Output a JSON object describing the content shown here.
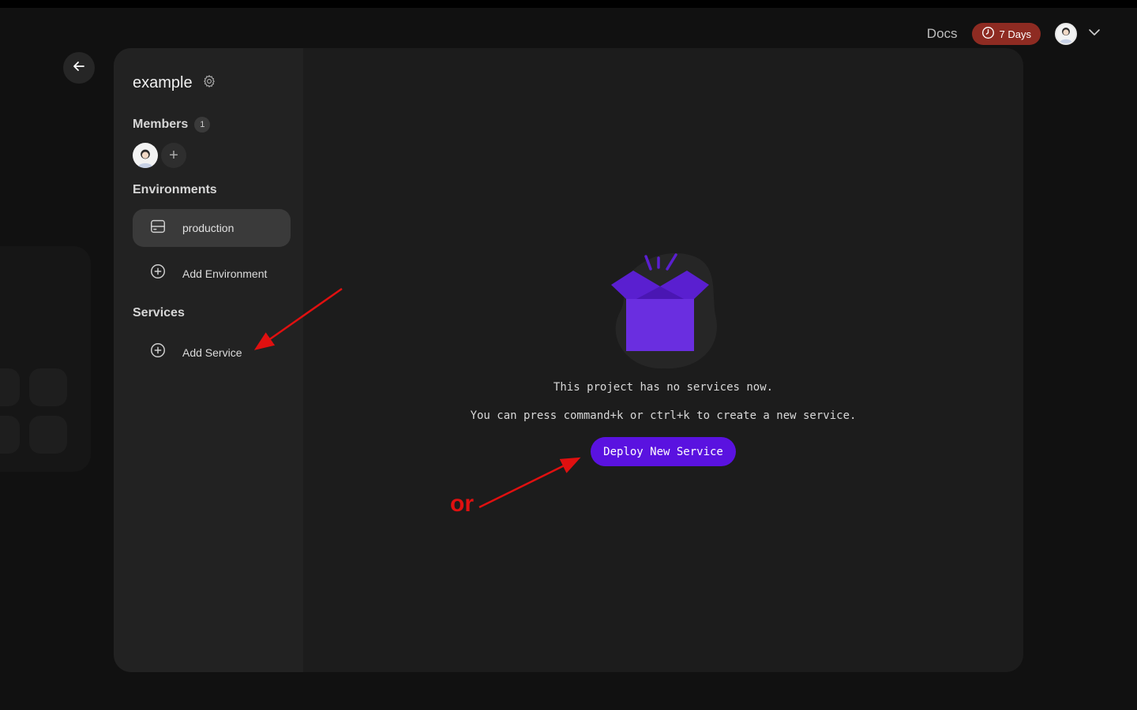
{
  "header": {
    "docs_label": "Docs",
    "trial_label": "7 Days",
    "trial_color": "#8e2b22"
  },
  "project": {
    "name": "example",
    "members_label": "Members",
    "members_count": "1",
    "environments_label": "Environments",
    "environments": [
      {
        "label": "production",
        "icon": "server-icon"
      }
    ],
    "add_environment_label": "Add Environment",
    "services_label": "Services",
    "add_service_label": "Add Service"
  },
  "empty_state": {
    "message": "This project has no services now.",
    "hint": "You can press command+k or ctrl+k to create a new service.",
    "deploy_button_label": "Deploy New Service",
    "accent_color": "#5a12e0"
  },
  "annotation": {
    "or_label": "or",
    "color": "#e01010"
  }
}
